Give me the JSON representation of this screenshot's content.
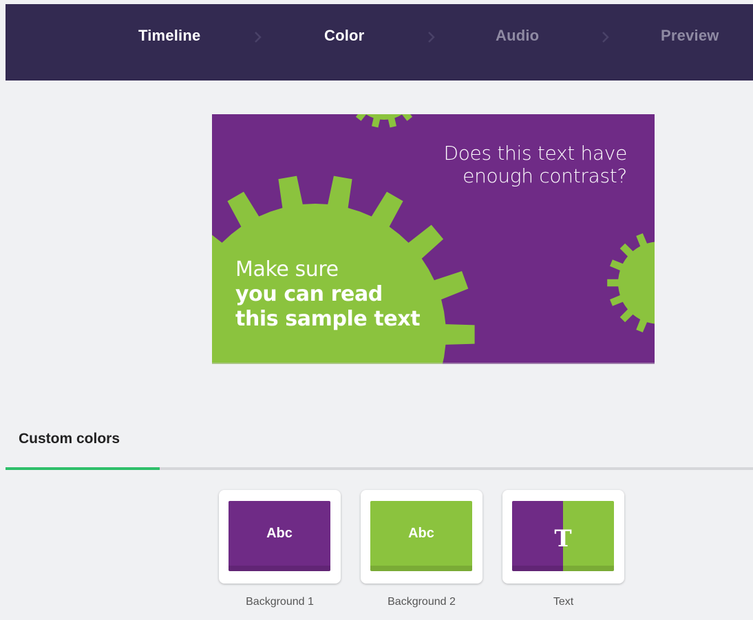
{
  "steps": [
    {
      "label": "Timeline",
      "state": "active"
    },
    {
      "label": "Color",
      "state": "active"
    },
    {
      "label": "Audio",
      "state": "inactive"
    },
    {
      "label": "Preview",
      "state": "inactive"
    }
  ],
  "preview": {
    "question_line1": "Does this text have",
    "question_line2": "enough contrast?",
    "sample_line1": "Make sure",
    "sample_line2": "you can read",
    "sample_line3": "this sample text"
  },
  "custom_colors": {
    "title": "Custom colors",
    "swatches": [
      {
        "label": "Background 1",
        "text": "Abc"
      },
      {
        "label": "Background 2",
        "text": "Abc"
      },
      {
        "label": "Text",
        "text": "T"
      }
    ]
  },
  "colors": {
    "header_bg": "#332a51",
    "purple": "#6f2b86",
    "green": "#8bc33e",
    "tab_indicator": "#2fbf6a"
  }
}
